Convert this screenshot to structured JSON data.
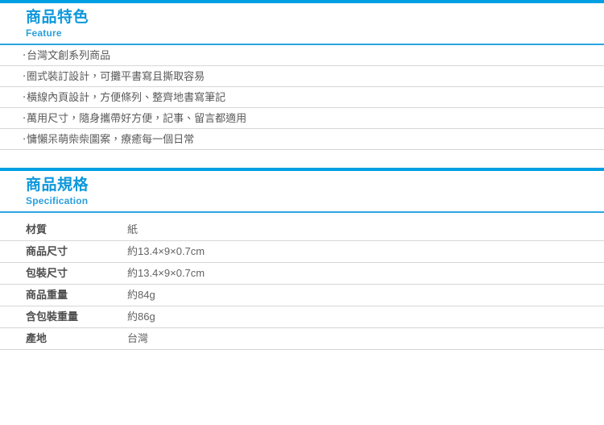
{
  "theme": {
    "accent": "#00a0e3",
    "heading_color": "#0d98db",
    "subheading_color": "#2a9fdc",
    "text_color": "#5a5a5a",
    "divider_color": "#d6d6d6"
  },
  "feature_section": {
    "title_cn": "商品特色",
    "title_en": "Feature",
    "bullet": "‧",
    "items": [
      "台灣文創系列商品",
      "圈式裝訂設計，可攤平書寫且撕取容易",
      "橫線內頁設計，方便條列、整齊地書寫筆記",
      "萬用尺寸，隨身攜帶好方便，記事、留言都適用",
      "慵懶呆萌柴柴圖案，療癒每一個日常"
    ]
  },
  "spec_section": {
    "title_cn": "商品規格",
    "title_en": "Specification",
    "rows": [
      {
        "label": "材質",
        "value": "紙"
      },
      {
        "label": "商品尺寸",
        "value": "約13.4×9×0.7cm"
      },
      {
        "label": "包裝尺寸",
        "value": "約13.4×9×0.7cm"
      },
      {
        "label": "商品重量",
        "value": "約84g"
      },
      {
        "label": "含包裝重量",
        "value": "約86g"
      },
      {
        "label": "產地",
        "value": "台灣"
      }
    ]
  }
}
